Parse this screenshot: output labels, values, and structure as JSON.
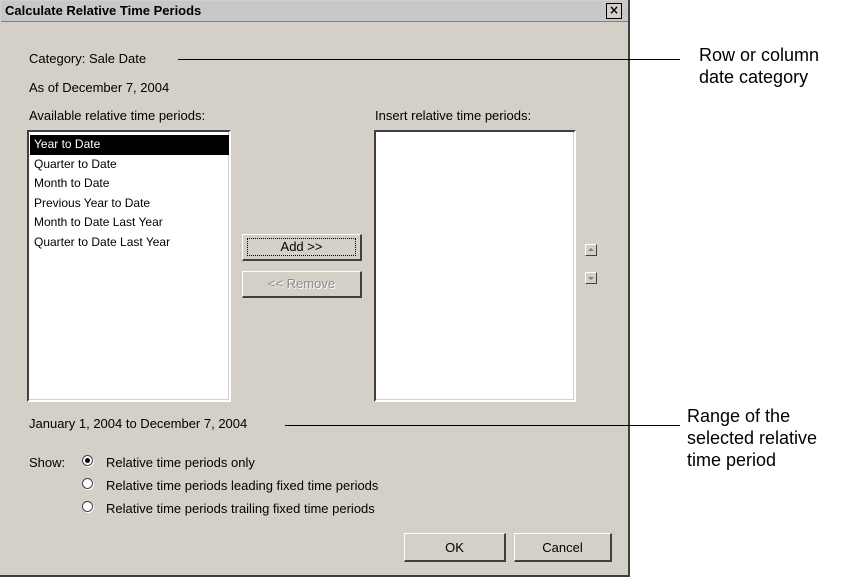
{
  "dialog": {
    "title": "Calculate Relative Time Periods",
    "close_label": "×",
    "category_label": "Category: Sale Date",
    "as_of_label": "As of December 7, 2004",
    "available_label": "Available relative time periods:",
    "insert_label": "Insert relative time periods:",
    "available_items": [
      "Year to Date",
      "Quarter to Date",
      "Month to Date",
      "Previous Year to Date",
      "Month to Date Last Year",
      "Quarter to Date Last Year"
    ],
    "selected_item": "Year to Date",
    "add_label": "Add >>",
    "remove_label": "<< Remove",
    "range_label": "January 1, 2004 to December 7, 2004",
    "show_label": "Show:",
    "radio_options": [
      "Relative time periods only",
      "Relative time periods leading fixed time periods",
      "Relative time periods trailing fixed time periods"
    ],
    "selected_radio": "Relative time periods only",
    "ok_label": "OK",
    "cancel_label": "Cancel"
  },
  "callouts": {
    "top": [
      "Row or column",
      "date category"
    ],
    "bottom": [
      "Range of the",
      "selected relative",
      "time period"
    ]
  }
}
